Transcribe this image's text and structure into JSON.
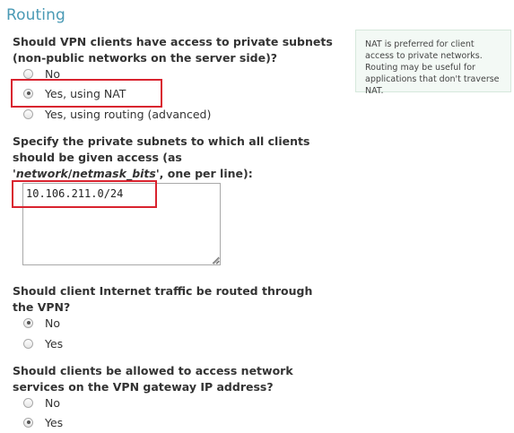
{
  "section": {
    "title": "Routing"
  },
  "help": {
    "text": "NAT is preferred for client access to private networks. Routing may be useful for applications that don't traverse NAT."
  },
  "private_access": {
    "question": "Should VPN clients have access to private subnets (non-public networks on the server side)?",
    "options": [
      {
        "label": "No",
        "checked": false
      },
      {
        "label": "Yes, using NAT",
        "checked": true
      },
      {
        "label": "Yes, using routing (advanced)",
        "checked": false
      }
    ]
  },
  "subnets": {
    "question_before": "Specify the private subnets to which all clients should be given access (as '",
    "question_network": "network",
    "question_sep": "/",
    "question_bits": "netmask_bits",
    "question_after": "', one per line):",
    "value": "10.106.211.0/24"
  },
  "internet_traffic": {
    "question": "Should client Internet traffic be routed through the VPN?",
    "options": [
      {
        "label": "No",
        "checked": true
      },
      {
        "label": "Yes",
        "checked": false
      }
    ]
  },
  "gateway_services": {
    "question": "Should clients be allowed to access network services on the VPN gateway IP address?",
    "options": [
      {
        "label": "No",
        "checked": false
      },
      {
        "label": "Yes",
        "checked": true
      }
    ]
  },
  "colors": {
    "title": "#4a9ab5",
    "highlight": "#d9232f",
    "help_bg": "#f3f9f5",
    "text": "#333333"
  }
}
